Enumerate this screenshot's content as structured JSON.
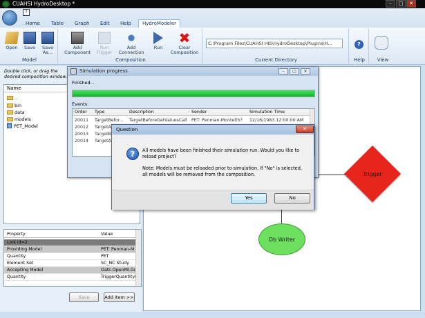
{
  "app": {
    "title": "CUAHSI HydroDesktop *"
  },
  "window_controls": {
    "minimize": "–",
    "maximize": "□",
    "close": "✕"
  },
  "menu_tabs": [
    "Home",
    "Table",
    "Graph",
    "Edit",
    "Help",
    "HydroModeler"
  ],
  "ribbon": {
    "model_group": {
      "label": "Model",
      "buttons": [
        "Open",
        "Save",
        "Save As..."
      ]
    },
    "composition_group": {
      "label": "Composition",
      "buttons": [
        "Add Component",
        "Run Trigger",
        "Add Connection",
        "Run",
        "Clear Composition"
      ]
    },
    "directory_group": {
      "label": "Current Directory",
      "path": "C:\\Program Files\\CUAHSI HIS\\HydroDesktop\\Plugins\\H..."
    },
    "help_group": {
      "label": "Help"
    },
    "view_group": {
      "label": "View"
    }
  },
  "left_panel": {
    "hint": "Double click, or drag the desired composition window.",
    "tree_header": "Name",
    "tree_items": [
      "..",
      "bin",
      "data",
      "models",
      "PET_Model"
    ],
    "properties_header": {
      "property": "Property",
      "value": "Value"
    },
    "properties": [
      {
        "k": "Link id=2",
        "v": ""
      },
      {
        "k": "Providing Model",
        "v": "PET: Penman-M"
      },
      {
        "k": "Quantity",
        "v": "PET"
      },
      {
        "k": "Element Set",
        "v": "SC_NC Study"
      },
      {
        "k": "Accepting Model",
        "v": "Oatc.OpenMI.Gui"
      },
      {
        "k": "Quantity",
        "v": "TriggerQuantityID"
      }
    ],
    "save_button": "Save",
    "add_item_button": "Add Item >>"
  },
  "canvas": {
    "trigger": "Trigger",
    "db_writer": "Db Writer"
  },
  "sim_window": {
    "title": "Simulation progress",
    "status": "Finished...",
    "progress": 1.0,
    "events_label": "Events:",
    "columns": [
      "Order",
      "Type",
      "Description",
      "Sender",
      "Simulation Time"
    ],
    "rows": [
      [
        "20011",
        "TargetBefor...",
        "TargetBeforeGetValuesCall",
        "PET: Penman-Monteith?",
        "12/16/1983 12:00:00 AM"
      ],
      [
        "20012",
        "TargetAf...",
        "",
        "",
        ""
      ],
      [
        "20013",
        "TargetBef...",
        "",
        "",
        ""
      ],
      [
        "20014",
        "TargetAf...",
        "",
        "",
        ""
      ]
    ]
  },
  "question_dialog": {
    "title": "Question",
    "message1": "All models have been finished their simulation run. Would you like to reload project?",
    "message2": "Note: Models must be reloaded prior to simulation. If \"No\" is selected, all models will be removed from the composition.",
    "yes": "Yes",
    "no": "No"
  },
  "colors": {
    "progress": "#14c232",
    "trigger": "#e8251c",
    "db_writer": "#6ee060"
  }
}
